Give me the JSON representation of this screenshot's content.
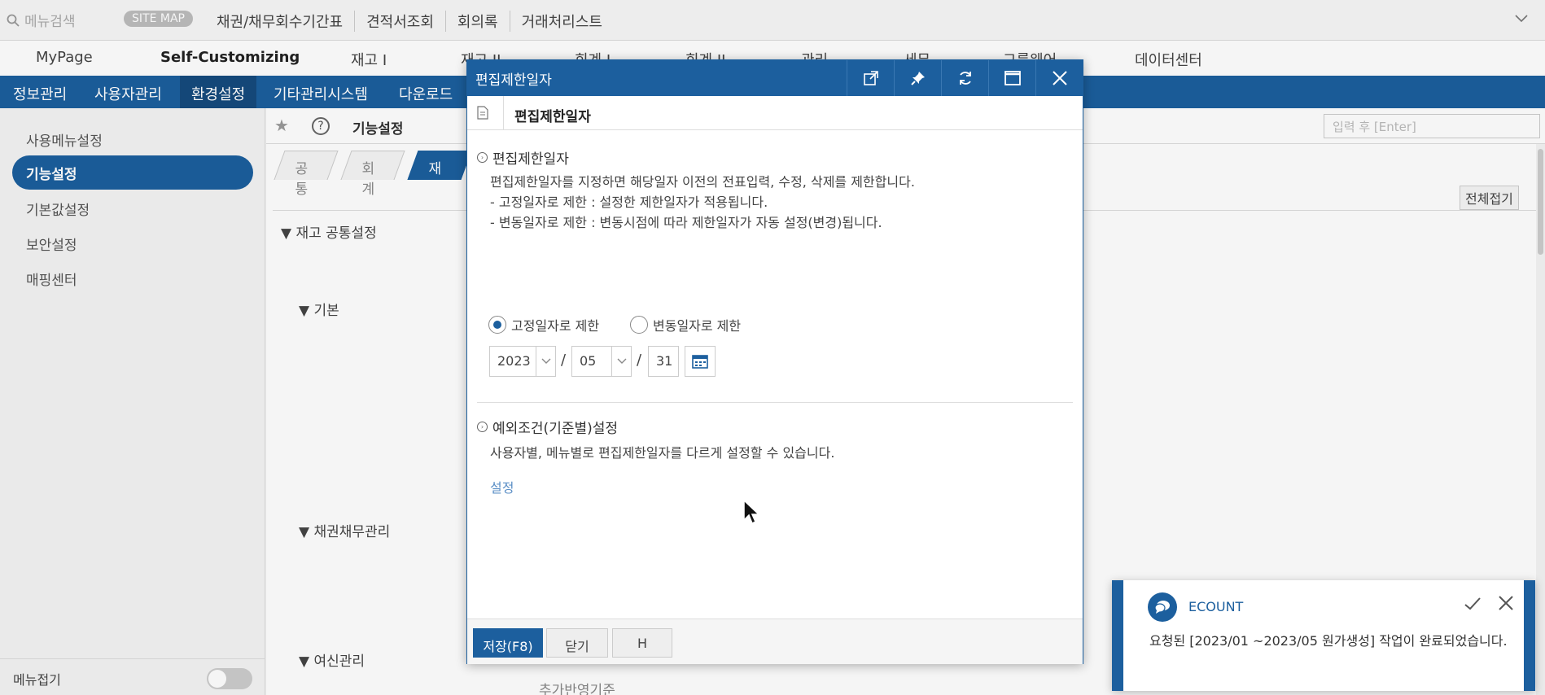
{
  "topbar": {
    "search_placeholder": "메뉴검색",
    "sitemap": "SITE MAP",
    "quick_links": [
      "채권/채무회수기간표",
      "견적서조회",
      "회의록",
      "거래처리스트"
    ]
  },
  "main_menu": [
    "MyPage",
    "Self-Customizing",
    "재고 I",
    "재고 II",
    "회계 I",
    "회계 II",
    "관리",
    "세무",
    "그룹웨어",
    "데이터센터"
  ],
  "sub_menu": [
    "정보관리",
    "사용자관리",
    "환경설정",
    "기타관리시스템",
    "다운로드"
  ],
  "sidebar": {
    "items": [
      "사용메뉴설정",
      "기능설정",
      "기본값설정",
      "보안설정",
      "매핑센터"
    ],
    "footer_label": "메뉴접기"
  },
  "content": {
    "title": "기능설정",
    "input_placeholder": "입력 후 [Enter]",
    "tabs": [
      "공통",
      "회계",
      "재고"
    ],
    "collapse_all": "전체접기",
    "sections": [
      "재고 공통설정",
      "기본",
      "채권채무관리",
      "여신관리",
      "추가반영기준"
    ]
  },
  "modal": {
    "title": "편집제한일자",
    "header": "편집제한일자",
    "section1_title": "편집제한일자",
    "desc1": "편집제한일자를 지정하면 해당일자 이전의 전표입력, 수정, 삭제를 제한합니다.",
    "desc2": "- 고정일자로 제한 : 설정한 제한일자가 적용됩니다.",
    "desc3": "- 변동일자로 제한 : 변동시점에 따라 제한일자가 자동 설정(변경)됩니다.",
    "radio_fixed": "고정일자로 제한",
    "radio_variable": "변동일자로 제한",
    "year": "2023",
    "month": "05",
    "day": "31",
    "section2_title": "예외조건(기준별)설정",
    "desc4": "사용자별, 메뉴별로 편집제한일자를 다르게 설정할 수 있습니다.",
    "link": "설정",
    "buttons": {
      "save": "저장(F8)",
      "close": "닫기",
      "h": "H"
    }
  },
  "toast": {
    "brand": "ECOUNT",
    "message": "요청된 [2023/01 ~2023/05 원가생성] 작업이 완료되었습니다."
  }
}
